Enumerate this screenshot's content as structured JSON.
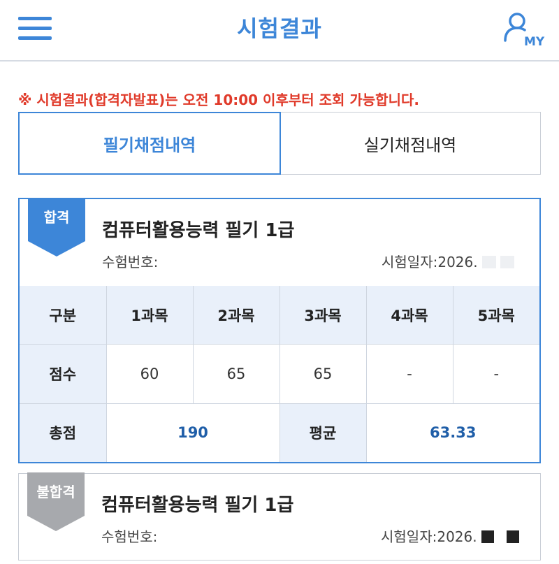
{
  "header": {
    "title": "시험결과",
    "menu_icon": "hamburger-menu-icon",
    "my_icon": "user-icon",
    "my_label": "MY"
  },
  "notice": "※ 시험결과(합격자발표)는 오전 10:00 이후부터 조회 가능합니다.",
  "tabs": [
    {
      "label": "필기채점내역",
      "active": true
    },
    {
      "label": "실기채점내역",
      "active": false
    }
  ],
  "results": [
    {
      "status": "합격",
      "status_color": "#3d86d8",
      "title": "컴퓨터활용능력 필기 1급",
      "exam_no_label": "수험번호:",
      "exam_date_label": "시험일자:2026.",
      "scores": {
        "headers": [
          "구분",
          "1과목",
          "2과목",
          "3과목",
          "4과목",
          "5과목"
        ],
        "score_label": "점수",
        "values": [
          "60",
          "65",
          "65",
          "-",
          "-"
        ],
        "total_label": "총점",
        "total": "190",
        "average_label": "평균",
        "average": "63.33"
      }
    },
    {
      "status": "불합격",
      "status_color": "#a7a9ad",
      "title": "컴퓨터활용능력 필기 1급",
      "exam_no_label": "수험번호:",
      "exam_date_label": "시험일자:2026."
    }
  ]
}
